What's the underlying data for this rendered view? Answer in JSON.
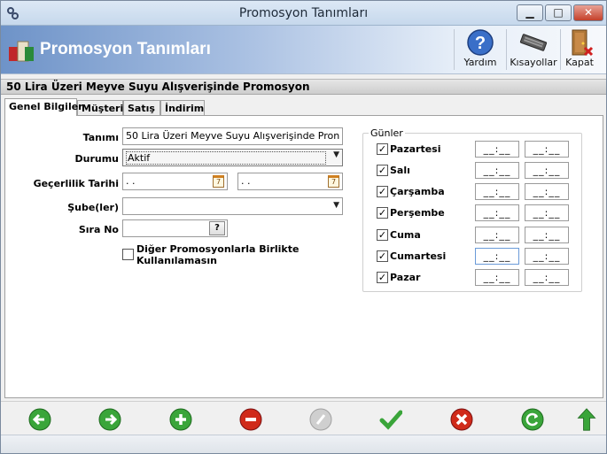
{
  "window": {
    "title": "Promosyon Tanımları"
  },
  "header": {
    "title": "Promosyon Tanımları",
    "toolbar": [
      {
        "label": "Yardım",
        "icon": "help-icon"
      },
      {
        "label": "Kısayollar",
        "icon": "keyboard-icon"
      },
      {
        "label": "Kapat",
        "icon": "door-exit-icon"
      }
    ]
  },
  "subtitle": "50 Lira Üzeri Meyve Suyu Alışverişinde Promosyon",
  "tabs": [
    "Genel Bilgiler",
    "Müşteri",
    "Satış",
    "İndirim"
  ],
  "form": {
    "tanimi_label": "Tanımı",
    "tanimi_value": "50 Lira Üzeri Meyve Suyu Alışverişinde Pron",
    "durumu_label": "Durumu",
    "durumu_value": "Aktif",
    "gecerlilik_label": "Geçerlilik Tarihi",
    "date_start": " .  .",
    "date_end": " .  .",
    "cal_glyph": "7",
    "sube_label": "Şube(ler)",
    "sube_value": "",
    "sira_label": "Sıra No",
    "sira_value": "",
    "sira_btn": "?",
    "diger_label": "Diğer Promosyonlarla Birlikte Kullanılamasın",
    "diger_checked": false
  },
  "gunler": {
    "label": "Günler",
    "time_placeholder": "__:__",
    "check_glyph": "✓",
    "days": [
      {
        "name": "Pazartesi",
        "checked": true
      },
      {
        "name": "Salı",
        "checked": true
      },
      {
        "name": "Çarşamba",
        "checked": true
      },
      {
        "name": "Perşembe",
        "checked": true
      },
      {
        "name": "Cuma",
        "checked": true
      },
      {
        "name": "Cumartesi",
        "checked": true
      },
      {
        "name": "Pazar",
        "checked": true
      }
    ]
  },
  "footer": [
    {
      "icon": "arrow-left-icon",
      "color": "#3aa53a"
    },
    {
      "icon": "arrow-right-icon",
      "color": "#3aa53a"
    },
    {
      "icon": "add-icon",
      "color": "#3aa53a"
    },
    {
      "icon": "remove-icon",
      "color": "#d02a1a"
    },
    {
      "icon": "edit-disabled-icon",
      "color": "#b8b8b8"
    },
    {
      "icon": "checkmark-icon",
      "color": "#3aa53a"
    },
    {
      "icon": "cancel-icon",
      "color": "#d02a1a"
    },
    {
      "icon": "refresh-icon",
      "color": "#3aa53a"
    },
    {
      "icon": "arrow-up-icon",
      "color": "#3aa53a"
    }
  ]
}
